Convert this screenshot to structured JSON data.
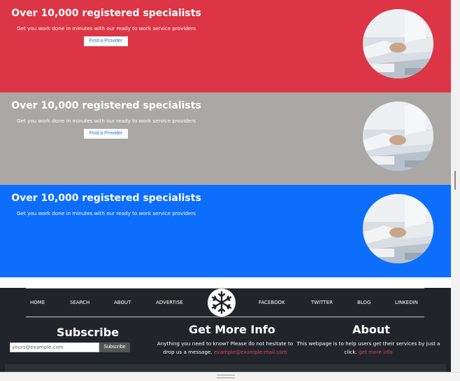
{
  "colors": {
    "banner_1": "#dc3545",
    "banner_2": "#a9a8a5",
    "banner_3": "#0d6efd",
    "footer": "#212529",
    "link": "#e64452",
    "button_text": "#2277cc"
  },
  "banners": [
    {
      "title": "Over 10,000 registered specialists",
      "subtitle": "Get you work done in minutes with our ready to work service providers",
      "button": "Find a Provider",
      "image_icon": "handshake-icon"
    },
    {
      "title": "Over 10,000 registered specialists",
      "subtitle": "Get you work done in minutes with our ready to work service providers",
      "button": "Find a Provider",
      "image_icon": "handshake-icon"
    },
    {
      "title": "Over 10,000 registered specialists",
      "subtitle": "Get you work done in minutes with our ready to work service providers",
      "image_icon": "handshake-icon"
    }
  ],
  "footer": {
    "nav": [
      "HOME",
      "SEARCH",
      "ABOUT",
      "ADVERTISE",
      "FACEBOOK",
      "TWITTER",
      "BLOG",
      "LINKEDIN"
    ],
    "logo_icon": "snowflake-icon",
    "subscribe": {
      "title": "Subscribe",
      "placeholder": "yours@example.com",
      "button": "Subscribe"
    },
    "more_info": {
      "title": "Get More Info",
      "text_line1": "Anything you need to know? Please do not hesitate to",
      "text_line2": "drop us a message.",
      "email": "example@example-mail.com"
    },
    "about": {
      "title": "About",
      "text_line1": "This webpage is to help users get their services by just a",
      "text_line2": "click.",
      "link": "get more info"
    }
  }
}
